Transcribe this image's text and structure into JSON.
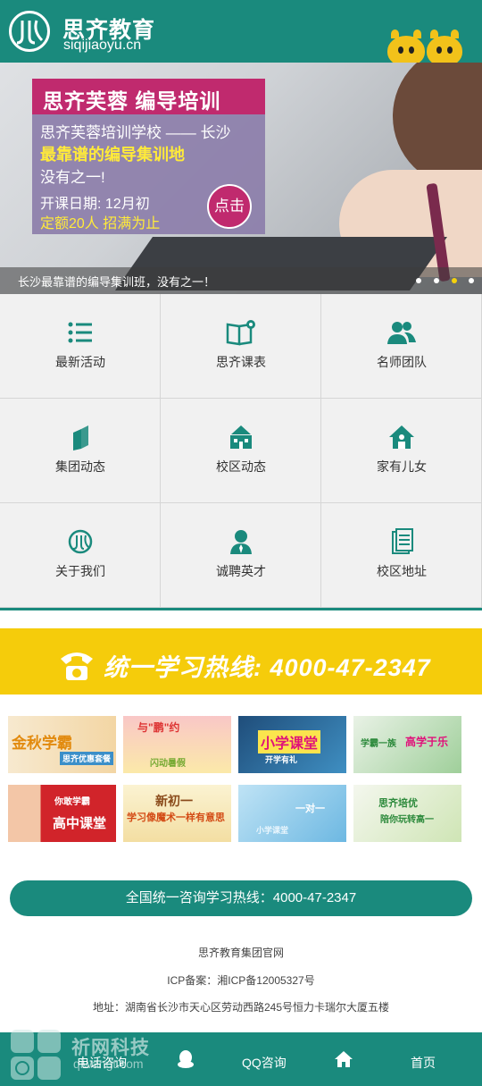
{
  "header": {
    "brand_cn": "思齐教育",
    "brand_en": "siqijiaoyu.cn"
  },
  "banner": {
    "promo_title": "思齐芙蓉  编导培训",
    "line1": "思齐芙蓉培训学校 —— 长沙",
    "line2": "最靠谱的编导集训地",
    "line3": "没有之一!",
    "line4": "开课日期: 12月初",
    "line5": "定额20人 招满为止",
    "cta": "点击",
    "caption": "长沙最靠谱的编导集训班，没有之一！",
    "slide_count": 4,
    "active_slide": 3
  },
  "menu": [
    {
      "label": "最新活动",
      "icon": "list-icon"
    },
    {
      "label": "思齐课表",
      "icon": "book-icon"
    },
    {
      "label": "名师团队",
      "icon": "team-icon"
    },
    {
      "label": "集团动态",
      "icon": "pages-icon"
    },
    {
      "label": "校区动态",
      "icon": "building-icon"
    },
    {
      "label": "家有儿女",
      "icon": "home-icon"
    },
    {
      "label": "关于我们",
      "icon": "logo-icon"
    },
    {
      "label": "诚聘英才",
      "icon": "person-icon"
    },
    {
      "label": "校区地址",
      "icon": "document-icon"
    }
  ],
  "hotline": {
    "text": "统一学习热线: 4000-47-2347"
  },
  "thumbnails": [
    {
      "text": "金秋学霸",
      "sub": "思齐优惠套餐"
    },
    {
      "text": "与\"鹏\"约",
      "sub": "闪动暑假"
    },
    {
      "text": "小学课堂",
      "sub": "开学有礼"
    },
    {
      "text": "学霸一族",
      "sub": "高学于乐"
    },
    {
      "text": "高中课堂",
      "sub": "你敢学霸"
    },
    {
      "text": "新初一",
      "sub": "学习像魔术一样有意思"
    },
    {
      "text": "一对一",
      "sub": "小学课堂"
    },
    {
      "text": "思齐培优",
      "sub": "陪你玩转高一"
    }
  ],
  "consult": {
    "label": "全国统一咨询学习热线：4000-47-2347"
  },
  "footer": {
    "site": "思齐教育集团官网",
    "icp": "ICP备案：湘ICP备12005327号",
    "address": "地址：湖南省长沙市天心区劳动西路245号恒力卡瑞尔大厦五楼"
  },
  "bottom_nav": {
    "call": "电话咨询",
    "qq": "QQ咨询",
    "home": "首页"
  },
  "watermark": {
    "text": "祈网科技",
    "url": "qiwangt.com"
  },
  "colors": {
    "primary": "#1a8a7d",
    "hotline_bg": "#f5cc0b",
    "promo_accent": "#c02a6e"
  }
}
